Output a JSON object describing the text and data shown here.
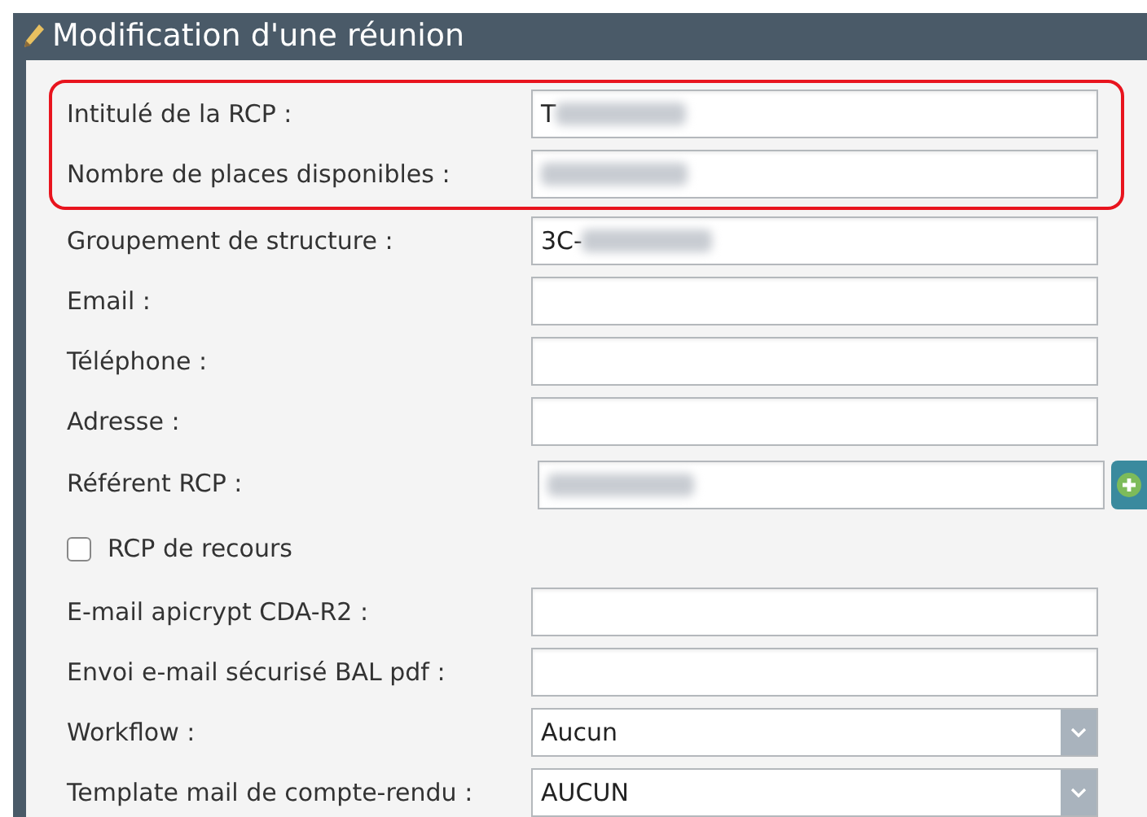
{
  "window": {
    "title": "Modification d'une réunion"
  },
  "sections": [
    {
      "highlighted": true,
      "fields": [
        {
          "kind": "text",
          "label": "Intitulé de la RCP :",
          "value": "T",
          "redacted": true
        },
        {
          "kind": "text",
          "label": "Nombre de places disponibles :",
          "redacted": true
        }
      ]
    },
    {
      "highlighted": false,
      "fields": [
        {
          "kind": "text",
          "label": "Groupement de structure :",
          "value": "3C-",
          "redacted": true
        },
        {
          "kind": "text",
          "label": "Email :",
          "redacted": false
        },
        {
          "kind": "text",
          "label": "Téléphone :",
          "redacted": false
        },
        {
          "kind": "text",
          "label": "Adresse :",
          "redacted": false
        },
        {
          "kind": "lookup",
          "label": "Référent RCP :",
          "redacted": true
        },
        {
          "kind": "checkbox",
          "label": "RCP de recours",
          "checked": false
        },
        {
          "kind": "text",
          "label": "E-mail apicrypt CDA-R2 :",
          "redacted": false
        },
        {
          "kind": "text",
          "label": "Envoi e-mail sécurisé BAL pdf :",
          "redacted": false
        },
        {
          "kind": "select",
          "label": "Workflow :",
          "value": "Aucun"
        },
        {
          "kind": "select",
          "label": "Template mail de compte-rendu :",
          "value": "AUCUN"
        }
      ]
    }
  ]
}
